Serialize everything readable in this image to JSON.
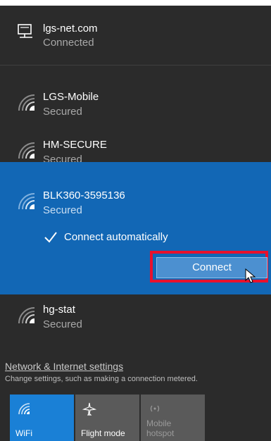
{
  "networks": {
    "ethernet": {
      "name": "lgs-net.com",
      "status": "Connected",
      "icon": "ethernet-icon"
    },
    "list": [
      {
        "name": "LGS-Mobile",
        "status": "Secured",
        "icon": "wifi-secured-icon"
      },
      {
        "name": "HM-SECURE",
        "status": "Secured",
        "icon": "wifi-secured-icon"
      },
      {
        "name": "BLK360-3595136",
        "status": "Secured",
        "icon": "wifi-secured-icon"
      },
      {
        "name": "hg-stat",
        "status": "Secured",
        "icon": "wifi-secured-icon"
      }
    ]
  },
  "selected_network": {
    "connect_automatically_label": "Connect automatically",
    "connect_automatically_checked": true,
    "connect_button": "Connect"
  },
  "settings": {
    "link": "Network & Internet settings",
    "description": "Change settings, such as making a connection metered."
  },
  "quick_actions": [
    {
      "label": "WiFi",
      "icon": "wifi-icon",
      "active": true
    },
    {
      "label": "Flight mode",
      "icon": "airplane-icon",
      "active": false
    },
    {
      "label": "Mobile hotspot",
      "label_lines": [
        "Mobile",
        "hotspot"
      ],
      "icon": "hotspot-icon",
      "active": false
    }
  ],
  "colors": {
    "background": "#2b2b2b",
    "selected": "#1267b5",
    "accent": "#1a80d6",
    "highlight": "#e8112d"
  }
}
